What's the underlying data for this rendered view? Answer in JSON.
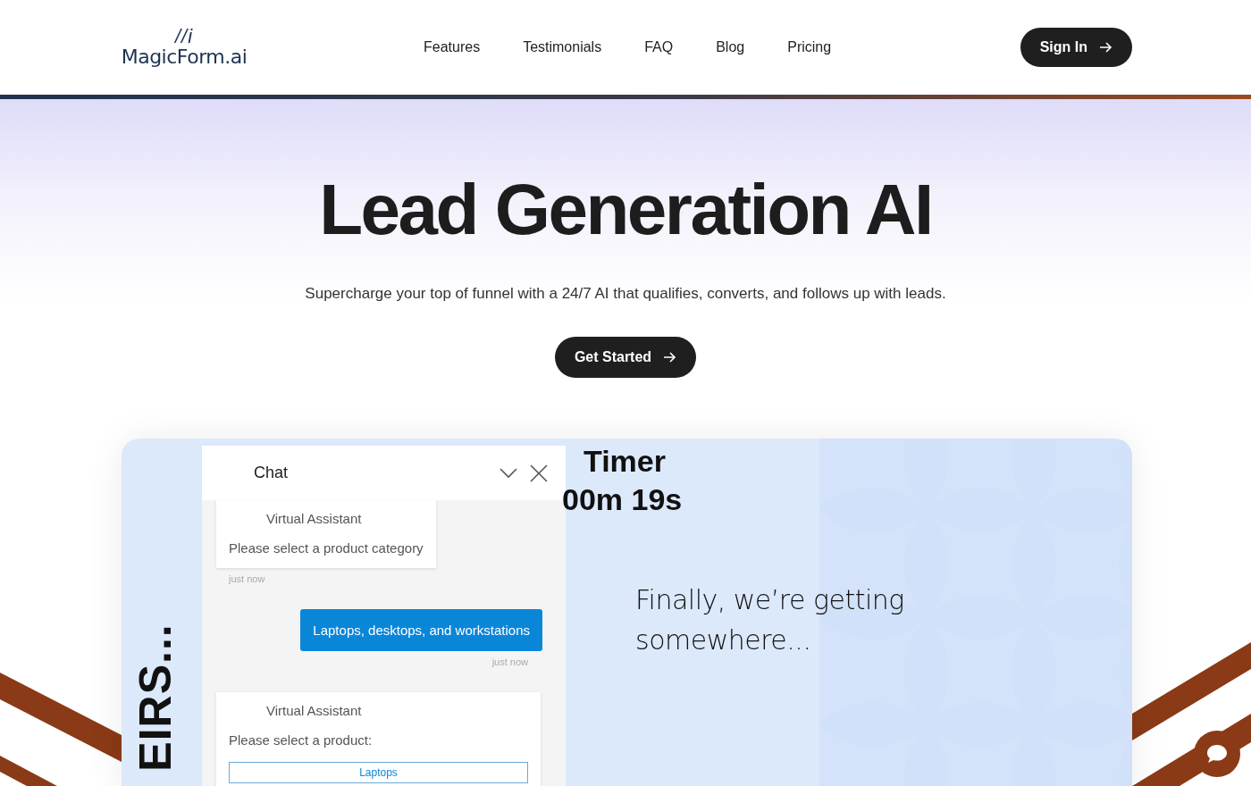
{
  "header": {
    "logo_mark": "//i",
    "logo_text": "MagicForm.ai",
    "nav": [
      {
        "label": "Features"
      },
      {
        "label": "Testimonials"
      },
      {
        "label": "FAQ"
      },
      {
        "label": "Blog"
      },
      {
        "label": "Pricing"
      }
    ],
    "sign_in": "Sign In"
  },
  "hero": {
    "title": "Lead Generation AI",
    "subtitle": "Supercharge your top of funnel with a 24/7 AI that qualifies, converts, and follows up with leads.",
    "cta": "Get Started"
  },
  "demo": {
    "side_text": "EIRS...",
    "chat": {
      "title": "Chat",
      "messages": [
        {
          "kind": "bot",
          "sender": "Virtual Assistant",
          "text": "Please select a product category",
          "time": "just now"
        },
        {
          "kind": "user",
          "text": "Laptops, desktops, and workstations",
          "time": "just now"
        },
        {
          "kind": "bot",
          "sender": "Virtual Assistant",
          "text": "Please select a product:",
          "select_value": "Laptops"
        }
      ]
    },
    "timer_label": "Timer",
    "timer_value": "00m 19s",
    "caption": "Finally, we’re getting somewhere..."
  }
}
